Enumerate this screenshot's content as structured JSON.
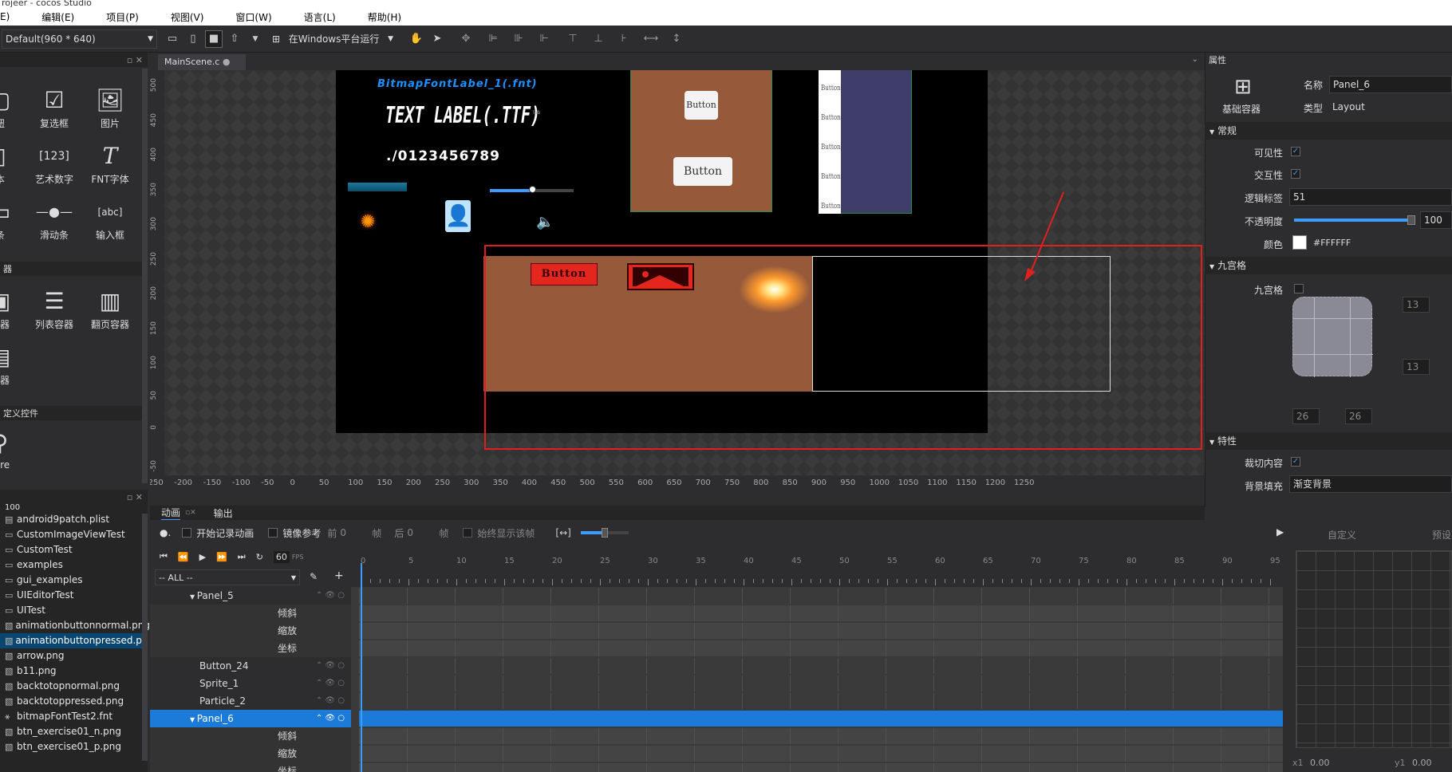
{
  "app_title": "rojeer - cocos Studio",
  "menu": [
    "E)",
    "编辑(E)",
    "项目(P)",
    "视图(V)",
    "窗口(W)",
    "语言(L)",
    "帮助(H)"
  ],
  "toolbar": {
    "resolution": "Default(960 * 640)",
    "run_label": "在Windows平台运行"
  },
  "widgets": {
    "row1": [
      "钮",
      "复选框",
      "图片"
    ],
    "row2": [
      "本",
      "艺术数字",
      "FNT字体"
    ],
    "row3": [
      "条",
      "滑动条",
      "输入框"
    ],
    "section_containers": "器",
    "row4": [
      "容器",
      "列表容器",
      "翻页容器"
    ],
    "row5": [
      "容器"
    ],
    "section_custom": "定义控件",
    "row6": [
      "ture"
    ]
  },
  "files": [
    "android9patch.plist",
    "CustomImageViewTest",
    "CustomTest",
    "examples",
    "gui_examples",
    "UIEditorTest",
    "UITest",
    "animationbuttonnormal.png",
    "animationbuttonpressed.pn",
    "arrow.png",
    "b11.png",
    "backtotopnormal.png",
    "backtotoppressed.png",
    "bitmapFontTest2.fnt",
    "btn_exercise01_n.png",
    "btn_exercise01_p.png"
  ],
  "files_top": "100",
  "scene_tab": "MainScene.c",
  "canvas": {
    "bitmap_label": "BitmapFontLabel_1(.fnt)",
    "ttf_label": "TEXT LABEL(.TTF)",
    "digits_label": "./0123456789",
    "button1": "Button",
    "button2": "Button",
    "red_button": "Button",
    "list_items": [
      "Button",
      "Button",
      "Button",
      "Button",
      "Button"
    ],
    "tiny_label": "lab"
  },
  "ruler_x": [
    "-250",
    "-200",
    "-150",
    "-100",
    "-50",
    "0",
    "50",
    "100",
    "150",
    "200",
    "250",
    "300",
    "350",
    "400",
    "450",
    "500",
    "550",
    "600",
    "650",
    "700",
    "750",
    "800",
    "850",
    "900",
    "950",
    "1000",
    "1050",
    "1100",
    "1150",
    "1200",
    "1250"
  ],
  "ruler_y": [
    "500",
    "450",
    "400",
    "350",
    "300",
    "250",
    "200",
    "150",
    "100",
    "50",
    "0",
    "-50"
  ],
  "properties": {
    "header": "属性",
    "type_icon_label": "基础容器",
    "name_label": "名称",
    "name_value": "Panel_6",
    "type_label": "类型",
    "type_value": "Layout",
    "sec_general": "常规",
    "visible_label": "可见性",
    "interactive_label": "交互性",
    "tag_label": "逻辑标签",
    "tag_value": "51",
    "opacity_label": "不透明度",
    "opacity_value": "100",
    "color_label": "颜色",
    "color_value": "#FFFFFF",
    "sec_nine": "九宫格",
    "nine_label": "九宫格",
    "nine_top": "13",
    "nine_bottom": "13",
    "nine_left": "26",
    "nine_right": "26",
    "sec_feature": "特性",
    "clip_label": "裁切内容",
    "bg_label": "背景填充",
    "bg_value": "渐变背景"
  },
  "bottom_tabs": {
    "anim": "动画",
    "output": "输出"
  },
  "timeline": {
    "record_label": "开始记录动画",
    "mirror_label": "镜像参考",
    "prev_label": "前",
    "prev_value": "0",
    "frame_unit": "帧",
    "next_label": "后",
    "next_value": "0",
    "frame_unit2": "帧",
    "always_label": "始终显示该帧",
    "fps_value": "60",
    "fps_unit": "FPS",
    "filter": "-- ALL --",
    "ticks": [
      "0",
      "5",
      "10",
      "15",
      "20",
      "25",
      "30",
      "35",
      "40",
      "45",
      "50",
      "55",
      "60",
      "65",
      "70",
      "75",
      "80",
      "85",
      "90",
      "95"
    ],
    "custom_label": "自定义",
    "preset_label": "预设",
    "x1_label": "x1",
    "x1_value": "0.00",
    "y1_label": "y1",
    "y1_value": "0.00",
    "rows": [
      {
        "label": "Panel_5",
        "kind": "node"
      },
      {
        "label": "倾斜",
        "kind": "prop"
      },
      {
        "label": "缩放",
        "kind": "prop"
      },
      {
        "label": "坐标",
        "kind": "prop"
      },
      {
        "label": "Button_24",
        "kind": "child"
      },
      {
        "label": "Sprite_1",
        "kind": "child"
      },
      {
        "label": "Particle_2",
        "kind": "child"
      },
      {
        "label": "Panel_6",
        "kind": "selected"
      },
      {
        "label": "倾斜",
        "kind": "prop"
      },
      {
        "label": "缩放",
        "kind": "prop"
      },
      {
        "label": "坐标",
        "kind": "prop"
      }
    ]
  },
  "colors": {
    "selection": "#1c7bd8",
    "accent": "#3c9cff",
    "highlight": "#e02020"
  }
}
